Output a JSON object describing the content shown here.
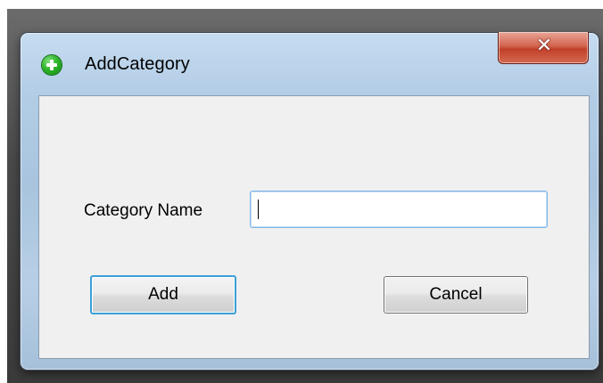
{
  "window": {
    "title": "AddCategory",
    "title_icon": "green-plus-circle-icon",
    "close_icon": "close-x-icon"
  },
  "form": {
    "category_label": "Category Name",
    "category_value": "",
    "category_placeholder": "",
    "add_label": "Add",
    "cancel_label": "Cancel"
  },
  "colors": {
    "title_icon_green": "#2fb52b",
    "close_button_red": "#c2402a",
    "focus_blue": "#3c9fd8",
    "client_background": "#f0f0f0"
  }
}
